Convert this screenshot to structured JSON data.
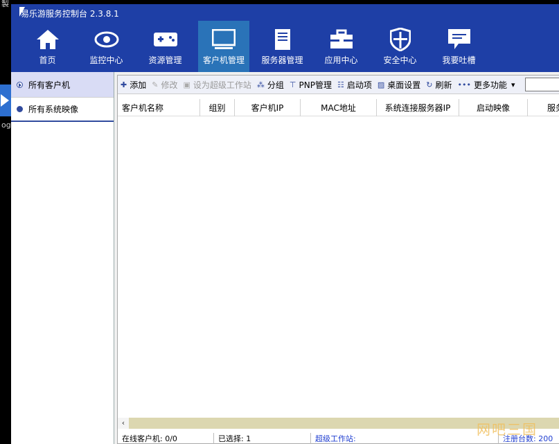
{
  "desktop": {
    "corner_text_top": "製",
    "corner_text_mid": "og"
  },
  "app": {
    "title": "易乐游服务控制台 2.3.8.1"
  },
  "nav": [
    {
      "label": "首页",
      "icon": "home-icon"
    },
    {
      "label": "监控中心",
      "icon": "eye-icon"
    },
    {
      "label": "资源管理",
      "icon": "gamepad-icon"
    },
    {
      "label": "客户机管理",
      "icon": "monitor-icon",
      "active": true
    },
    {
      "label": "服务器管理",
      "icon": "server-icon"
    },
    {
      "label": "应用中心",
      "icon": "toolbox-icon"
    },
    {
      "label": "安全中心",
      "icon": "shield-icon"
    },
    {
      "label": "我要吐槽",
      "icon": "feedback-icon"
    }
  ],
  "sidebar": {
    "items": [
      {
        "label": "所有客户机"
      },
      {
        "label": "所有系统映像"
      }
    ]
  },
  "toolbar": {
    "add": "添加",
    "edit": "修改",
    "super_ws": "设为超级工作站",
    "group": "分组",
    "pnp": "PNP管理",
    "boot_items": "启动项",
    "desktop_settings": "桌面设置",
    "refresh": "刷新",
    "more": "更多功能"
  },
  "table": {
    "columns": [
      "客户机名称",
      "组别",
      "客户机IP",
      "MAC地址",
      "系统连接服务器IP",
      "启动映像",
      "服务"
    ]
  },
  "status": {
    "online": "在线客户机: 0/0",
    "selected": "已选择: 1",
    "super_ws": "超级工作站:",
    "registered": "注册台数: 200"
  },
  "watermark": "网吧三国",
  "colors": {
    "header": "#1e3fa6",
    "active_nav": "#2a73b8",
    "accent": "#304a9e"
  }
}
